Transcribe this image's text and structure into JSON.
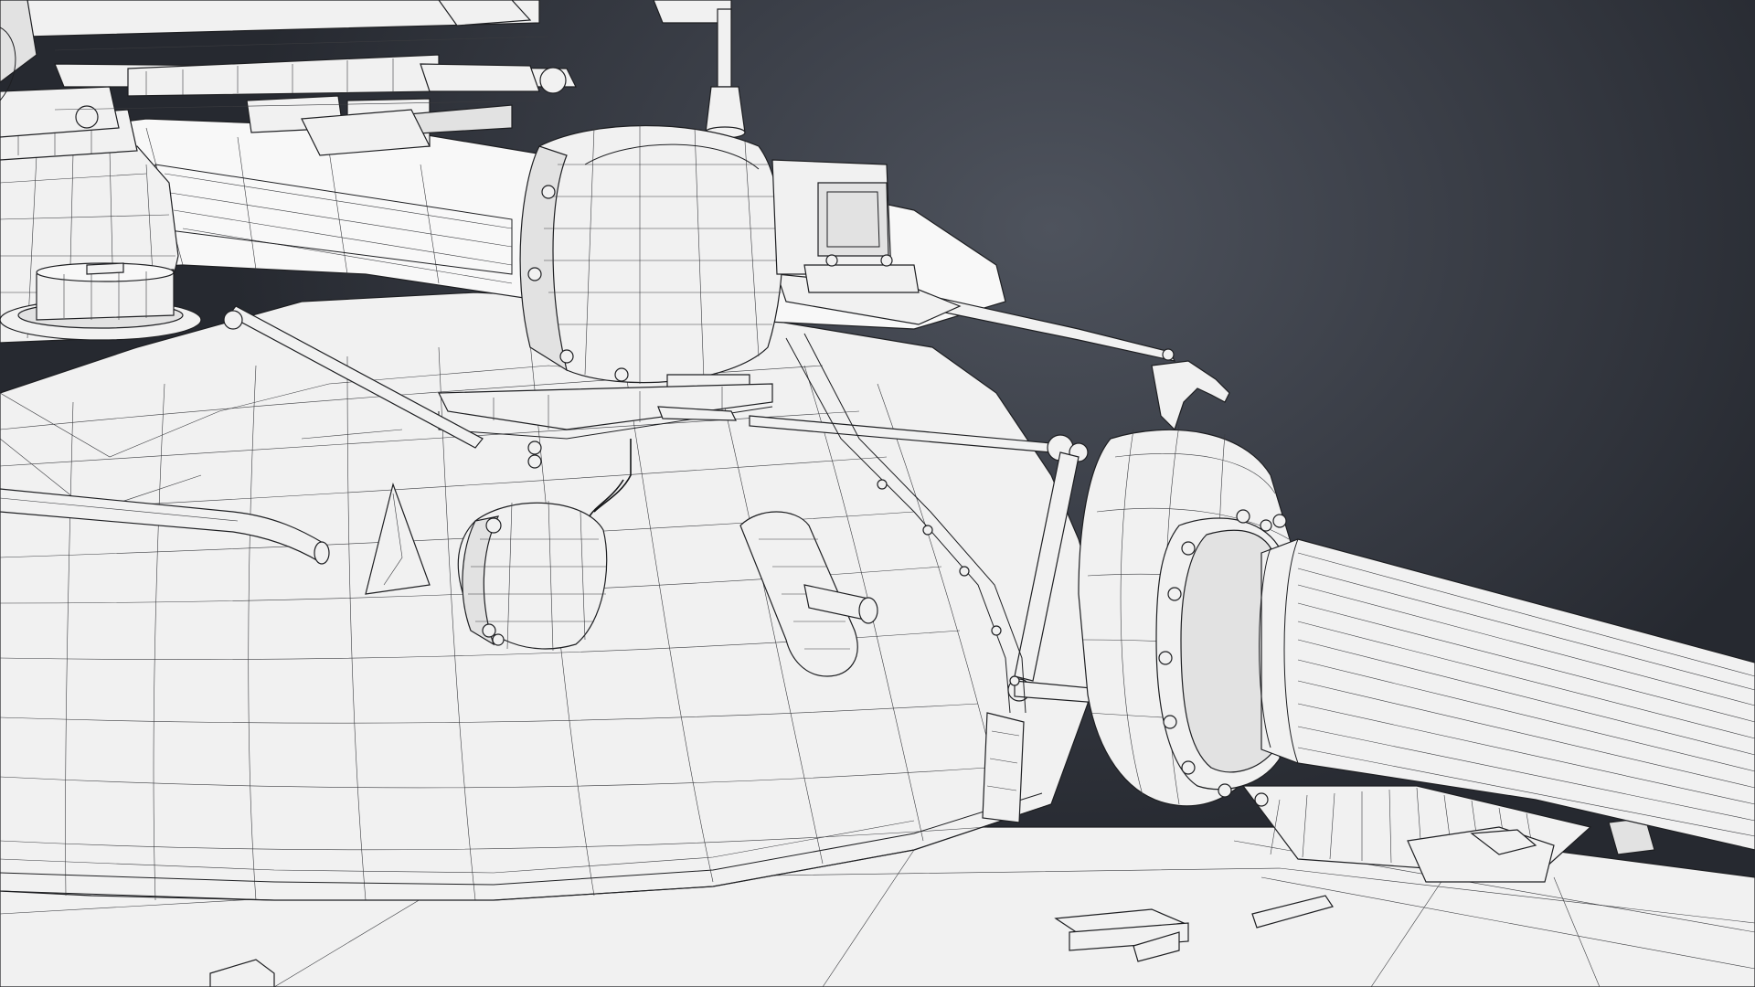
{
  "scene": {
    "subject": "wireframe-tank-turret",
    "background_color": "#3c4049",
    "background_edge_color": "#262930",
    "mesh_fill_color": "#f1f1f1",
    "wire_color": "#1e1f22"
  }
}
